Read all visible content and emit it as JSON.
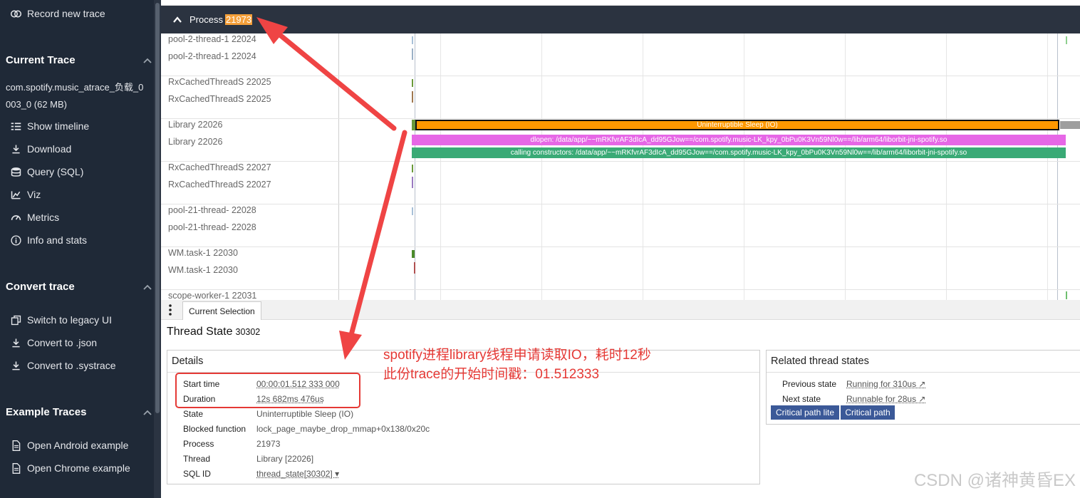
{
  "sidebar": {
    "record_label": "Record new trace",
    "current_trace_title": "Current Trace",
    "trace_name": "com.spotify.music_atrace_负载_0003_0 (62 MB)",
    "current_trace_items": [
      {
        "label": "Show timeline",
        "icon": "timeline-icon"
      },
      {
        "label": "Download",
        "icon": "download-icon"
      },
      {
        "label": "Query (SQL)",
        "icon": "database-icon"
      },
      {
        "label": "Viz",
        "icon": "chart-icon"
      },
      {
        "label": "Metrics",
        "icon": "gauge-icon"
      },
      {
        "label": "Info and stats",
        "icon": "info-icon"
      }
    ],
    "convert_title": "Convert trace",
    "convert_items": [
      {
        "label": "Switch to legacy UI",
        "icon": "switch-icon"
      },
      {
        "label": "Convert to .json",
        "icon": "download-icon"
      },
      {
        "label": "Convert to .systrace",
        "icon": "download-icon"
      }
    ],
    "examples_title": "Example Traces",
    "example_items": [
      {
        "label": "Open Android example",
        "icon": "document-icon"
      },
      {
        "label": "Open Chrome example",
        "icon": "document-icon"
      }
    ]
  },
  "process": {
    "label": "Process",
    "pid": "21973"
  },
  "tracks": [
    "pool-2-thread-1 22024",
    "pool-2-thread-1 22024",
    "RxCachedThreadS 22025",
    "RxCachedThreadS 22025",
    "Library 22026",
    "Library 22026",
    "RxCachedThreadS 22027",
    "RxCachedThreadS 22027",
    "pool-21-thread- 22028",
    "pool-21-thread- 22028",
    "WM.task-1 22030",
    "WM.task-1 22030",
    "scope-worker-1 22031"
  ],
  "slices": {
    "sleep": "Uninterruptible Sleep (IO)",
    "dlopen": "dlopen: /data/app/~~mRKfvrAF3dIcA_dd95GJow==/com.spotify.music-LK_kpy_0bPu0K3Vn59Nl0w==/lib/arm64/liborbit-jni-spotify.so",
    "constructors": "calling constructors: /data/app/~~mRKfvrAF3dIcA_dd95GJow==/com.spotify.music-LK_kpy_0bPu0K3Vn59Nl0w==/lib/arm64/liborbit-jni-spotify.so"
  },
  "colors": {
    "sleep": "#ff9800",
    "dlopen": "#e667e6",
    "constructors": "#3aaa76",
    "sidebar": "#1f2937",
    "annotation": "#e53935",
    "button": "#3b5998"
  },
  "panel": {
    "tab_label": "Current Selection",
    "title": "Thread State",
    "title_id": "30302",
    "details_heading": "Details",
    "details": [
      {
        "key": "Start time",
        "value": "00:00:01.512 333 000",
        "link": true
      },
      {
        "key": "Duration",
        "value": "12s 682ms 476us",
        "link": true
      },
      {
        "key": "State",
        "value": "Uninterruptible Sleep (IO)",
        "link": false
      },
      {
        "key": "Blocked function",
        "value": "lock_page_maybe_drop_mmap+0x138/0x20c",
        "link": false
      },
      {
        "key": "Process",
        "value": "21973",
        "link": false
      },
      {
        "key": "Thread",
        "value": "Library [22026]",
        "link": false
      },
      {
        "key": "SQL ID",
        "value": "thread_state[30302] ▾",
        "link": true
      }
    ],
    "related_heading": "Related thread states",
    "related": [
      {
        "key": "Previous state",
        "value": "Running for 310us ↗"
      },
      {
        "key": "Next state",
        "value": "Runnable for 28us ↗"
      }
    ],
    "buttons": [
      "Critical path lite",
      "Critical path"
    ]
  },
  "annotation": {
    "line1": "spotify进程library线程申请读取IO，耗时12秒",
    "line2": "此份trace的开始时间戳：01.512333"
  },
  "watermark": "CSDN @诸神黄昏EX"
}
